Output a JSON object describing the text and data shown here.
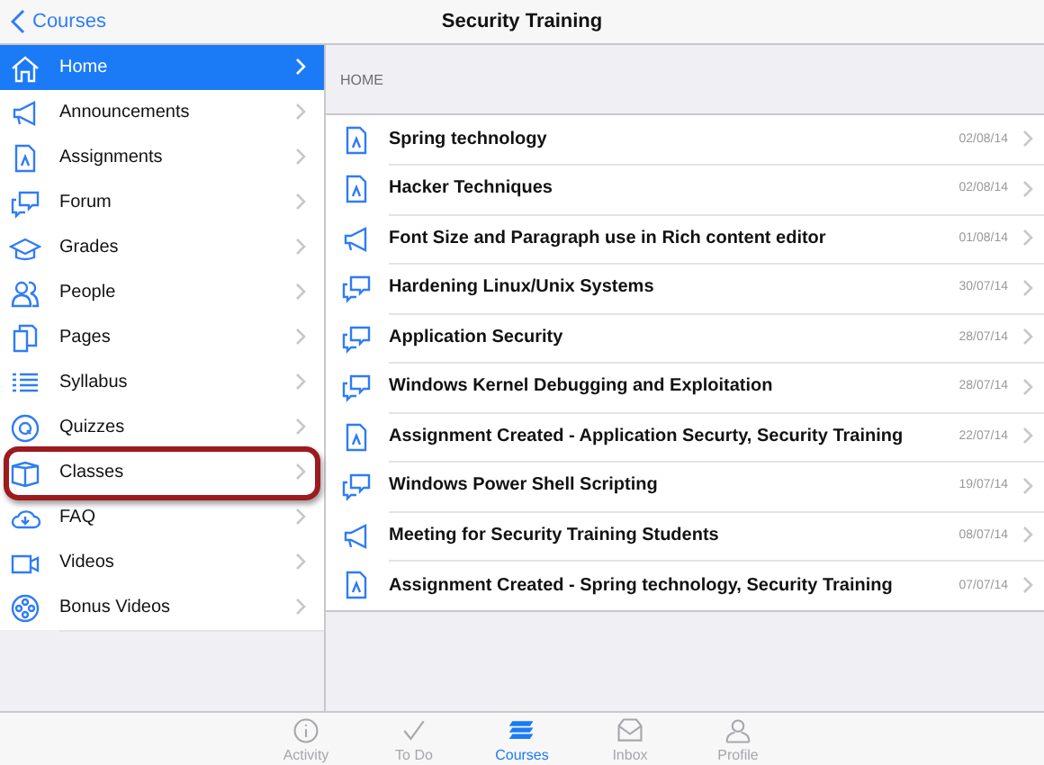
{
  "nav": {
    "back": "Courses",
    "title": "Security Training"
  },
  "sidebar": {
    "items": [
      {
        "label": "Home",
        "selected": true,
        "highlighted": false
      },
      {
        "label": "Announcements",
        "selected": false,
        "highlighted": false
      },
      {
        "label": "Assignments",
        "selected": false,
        "highlighted": false
      },
      {
        "label": "Forum",
        "selected": false,
        "highlighted": false
      },
      {
        "label": "Grades",
        "selected": false,
        "highlighted": false
      },
      {
        "label": "People",
        "selected": false,
        "highlighted": false
      },
      {
        "label": "Pages",
        "selected": false,
        "highlighted": false
      },
      {
        "label": "Syllabus",
        "selected": false,
        "highlighted": false
      },
      {
        "label": "Quizzes",
        "selected": false,
        "highlighted": false
      },
      {
        "label": "Classes",
        "selected": false,
        "highlighted": true
      },
      {
        "label": "FAQ",
        "selected": false,
        "highlighted": false
      },
      {
        "label": "Videos",
        "selected": false,
        "highlighted": false
      },
      {
        "label": "Bonus Videos",
        "selected": false,
        "highlighted": false
      }
    ]
  },
  "content": {
    "section": "HOME",
    "rows": [
      {
        "kind": "assignment",
        "title": "Spring technology",
        "date": "02/08/14"
      },
      {
        "kind": "assignment",
        "title": "Hacker Techniques",
        "date": "02/08/14"
      },
      {
        "kind": "announcement",
        "title": "Font Size and Paragraph use in Rich content editor",
        "date": "01/08/14"
      },
      {
        "kind": "discussion",
        "title": "Hardening Linux/Unix Systems",
        "date": "30/07/14"
      },
      {
        "kind": "discussion",
        "title": "Application Security",
        "date": "28/07/14"
      },
      {
        "kind": "discussion",
        "title": "Windows Kernel Debugging and Exploitation",
        "date": "28/07/14"
      },
      {
        "kind": "assignment",
        "title": "Assignment Created - Application Securty, Security Training",
        "date": "22/07/14"
      },
      {
        "kind": "discussion",
        "title": "Windows Power Shell Scripting",
        "date": "19/07/14"
      },
      {
        "kind": "announcement",
        "title": "Meeting for Security Training Students",
        "date": "08/07/14"
      },
      {
        "kind": "assignment",
        "title": "Assignment Created - Spring technology, Security Training",
        "date": "07/07/14"
      }
    ]
  },
  "tabs": [
    {
      "label": "Activity",
      "selected": false
    },
    {
      "label": "To Do",
      "selected": false
    },
    {
      "label": "Courses",
      "selected": true
    },
    {
      "label": "Inbox",
      "selected": false
    },
    {
      "label": "Profile",
      "selected": false
    }
  ]
}
